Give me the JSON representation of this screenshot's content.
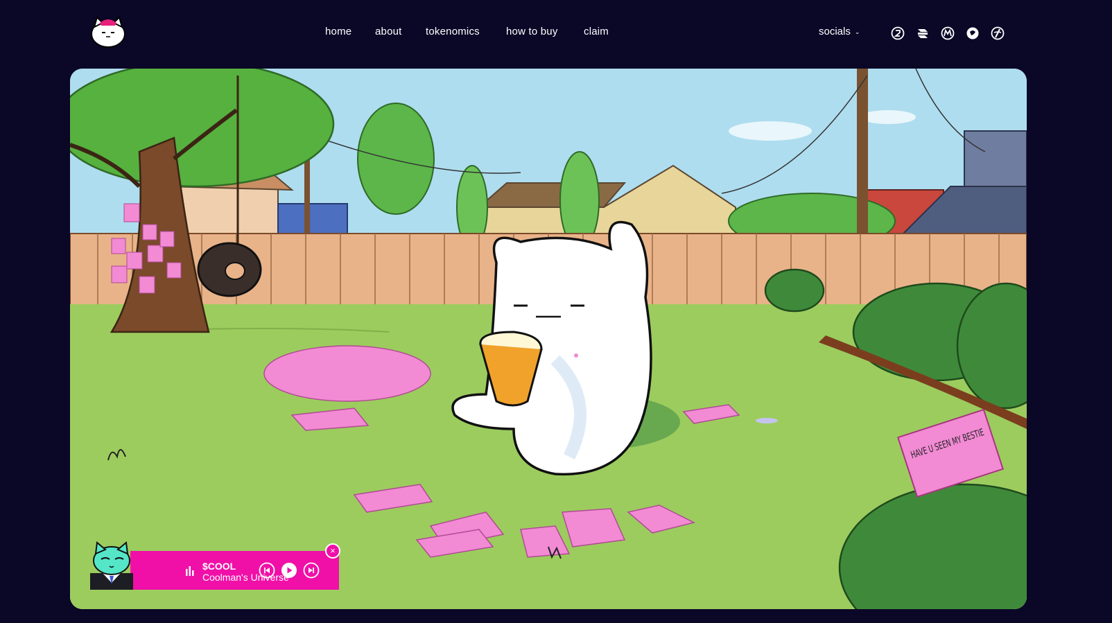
{
  "brand": {
    "logo_icon": "cat-head-logo-icon"
  },
  "nav": {
    "links": [
      "home",
      "about",
      "tokenomics",
      "how to buy",
      "claim"
    ],
    "socials_label": "socials",
    "social_icons": [
      "coin-badge-icon",
      "ghost-cube-icon",
      "mcap-m-icon",
      "chat-bubble-icon",
      "slash-circle-icon"
    ]
  },
  "hero": {
    "sign_text": "HAVE U SEEN MY BESTIE"
  },
  "player": {
    "title": "$COOL",
    "subtitle": "Coolman's Universe",
    "buttons": [
      "previous-icon",
      "play-icon",
      "next-icon"
    ],
    "close_label": "×"
  },
  "colors": {
    "background": "#0b0727",
    "accent": "#f010a8",
    "sky": "#aeddef",
    "grass": "#9ccc5e"
  }
}
